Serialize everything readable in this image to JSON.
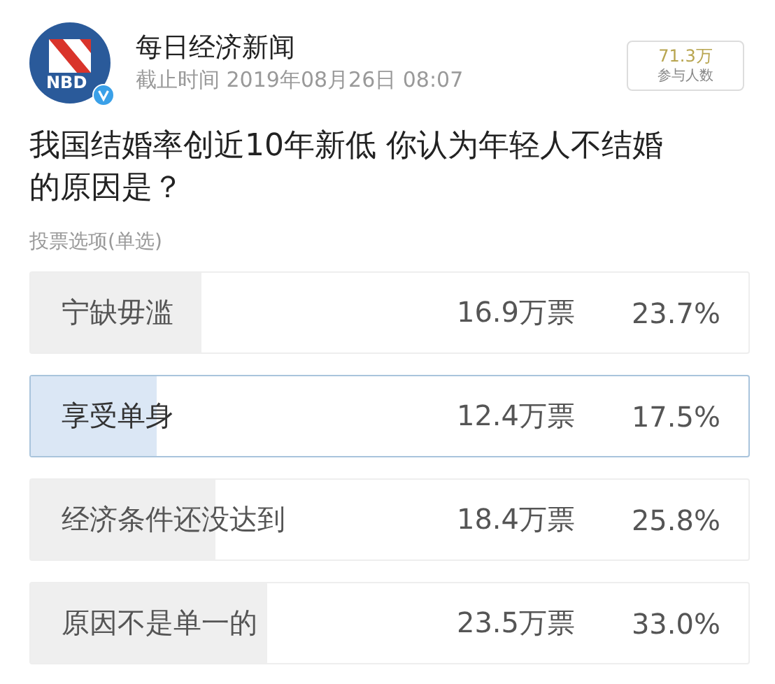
{
  "header": {
    "logo_text": "NBD",
    "verified": true,
    "name": "每日经济新闻",
    "deadline": "截止时间 2019年08月26日 08:07",
    "participants": {
      "count": "71.3万",
      "label": "参与人数"
    }
  },
  "question": "我国结婚率创近10年新低 你认为年轻人不结婚的原因是？",
  "vote_type": "投票选项(单选)",
  "options": [
    {
      "label": "宁缺毋滥",
      "votes": "16.9万票",
      "percent": "23.7%",
      "level": 0.237,
      "selected": false
    },
    {
      "label": "享受单身",
      "votes": "12.4万票",
      "percent": "17.5%",
      "level": 0.175,
      "selected": true
    },
    {
      "label": "经济条件还没达到",
      "votes": "18.4万票",
      "percent": "25.8%",
      "level": 0.258,
      "selected": false
    },
    {
      "label": "原因不是单一的",
      "votes": "23.5万票",
      "percent": "33.0%",
      "level": 0.33,
      "selected": false
    }
  ]
}
